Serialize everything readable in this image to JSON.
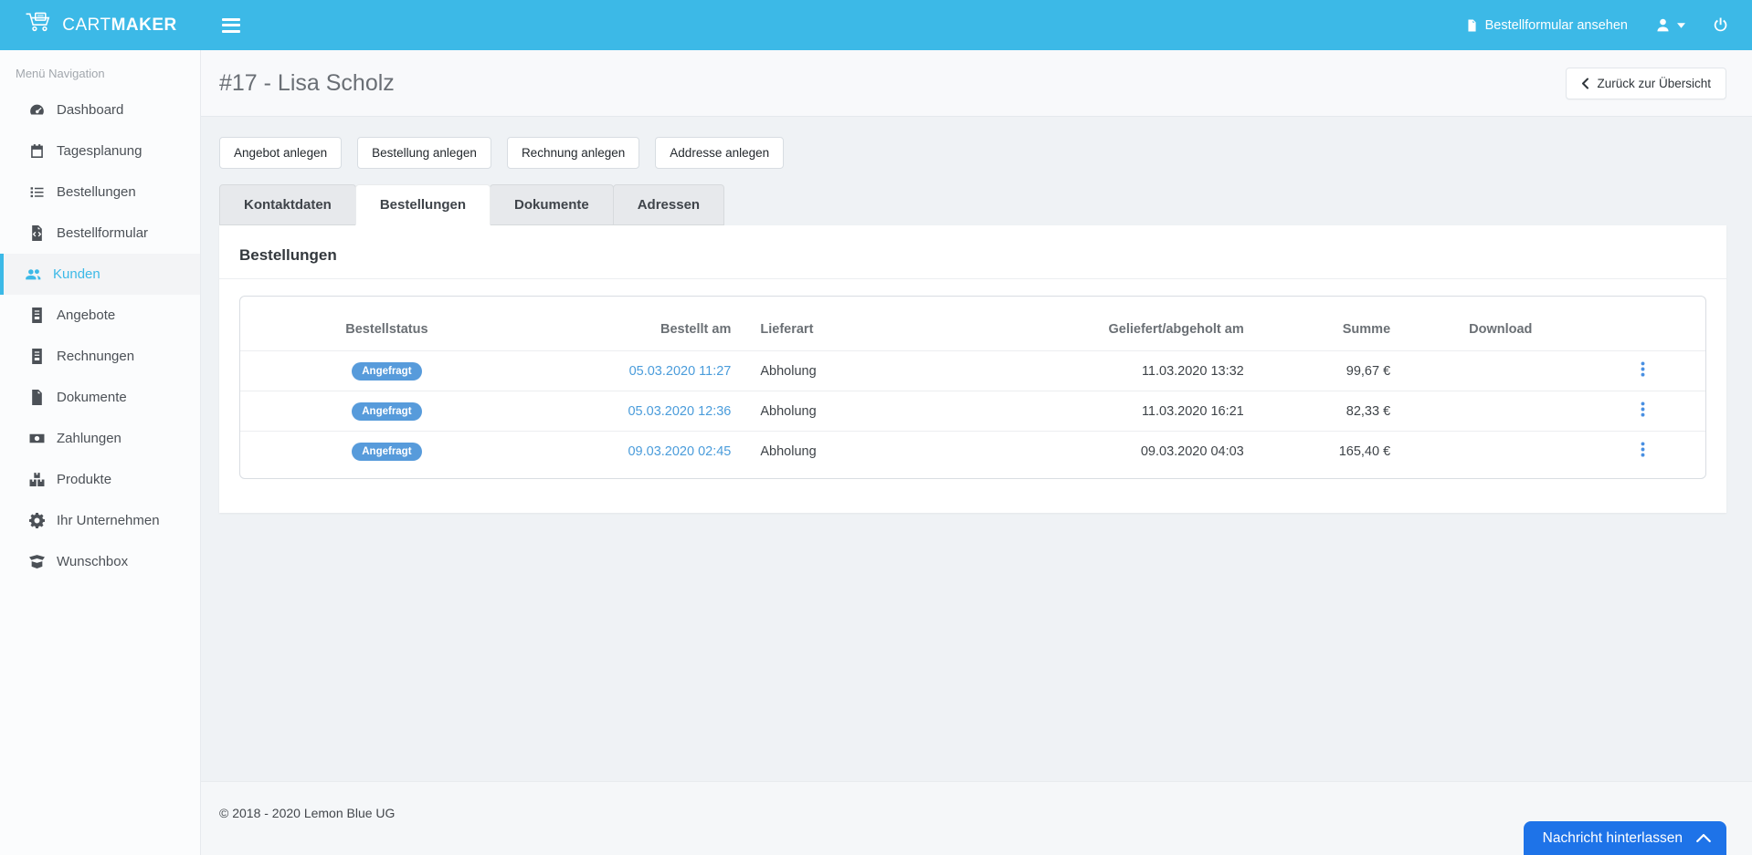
{
  "colors": {
    "accent": "#3cb9e7",
    "primary": "#1e73e8",
    "badge": "#579bdb",
    "link": "#4a9cdb",
    "link-strong": "#4a90e2"
  },
  "topbar": {
    "brand_cart": "CART",
    "brand_maker": "MAKER",
    "order_form_link": "Bestellformular ansehen"
  },
  "sidebar": {
    "section_label": "Menü Navigation",
    "items": [
      {
        "label": "Dashboard",
        "icon": "tachometer-icon",
        "active": false
      },
      {
        "label": "Tagesplanung",
        "icon": "calendar-icon",
        "active": false
      },
      {
        "label": "Bestellungen",
        "icon": "list-icon",
        "active": false
      },
      {
        "label": "Bestellformular",
        "icon": "file-code-icon",
        "active": false
      },
      {
        "label": "Kunden",
        "icon": "users-icon",
        "active": true
      },
      {
        "label": "Angebote",
        "icon": "file-invoice-icon",
        "active": false
      },
      {
        "label": "Rechnungen",
        "icon": "file-invoice-icon",
        "active": false
      },
      {
        "label": "Dokumente",
        "icon": "file-icon",
        "active": false
      },
      {
        "label": "Zahlungen",
        "icon": "money-bill-icon",
        "active": false
      },
      {
        "label": "Produkte",
        "icon": "boxes-icon",
        "active": false
      },
      {
        "label": "Ihr Unternehmen",
        "icon": "gear-icon",
        "active": false
      },
      {
        "label": "Wunschbox",
        "icon": "box-open-icon",
        "active": false
      }
    ]
  },
  "header": {
    "title": "#17 - Lisa Scholz",
    "back_button": "Zurück zur Übersicht"
  },
  "actions": {
    "create_offer": "Angebot anlegen",
    "create_order": "Bestellung anlegen",
    "create_invoice": "Rechnung anlegen",
    "create_address": "Addresse anlegen"
  },
  "tabs": [
    {
      "label": "Kontaktdaten",
      "active": false
    },
    {
      "label": "Bestellungen",
      "active": true
    },
    {
      "label": "Dokumente",
      "active": false
    },
    {
      "label": "Adressen",
      "active": false
    }
  ],
  "panel": {
    "heading": "Bestellungen"
  },
  "table": {
    "columns": {
      "status": "Bestellstatus",
      "ordered_at": "Bestellt am",
      "delivery": "Lieferart",
      "delivered_at": "Geliefert/abgeholt am",
      "sum": "Summe",
      "download": "Download"
    },
    "rows": [
      {
        "status": "Angefragt",
        "ordered_at": "05.03.2020 11:27",
        "delivery": "Abholung",
        "delivered_at": "11.03.2020 13:32",
        "sum": "99,67 €"
      },
      {
        "status": "Angefragt",
        "ordered_at": "05.03.2020 12:36",
        "delivery": "Abholung",
        "delivered_at": "11.03.2020 16:21",
        "sum": "82,33 €"
      },
      {
        "status": "Angefragt",
        "ordered_at": "09.03.2020 02:45",
        "delivery": "Abholung",
        "delivered_at": "09.03.2020 04:03",
        "sum": "165,40 €"
      }
    ]
  },
  "footer": {
    "copyright": "© 2018 - 2020 Lemon Blue UG"
  },
  "chat": {
    "label": "Nachricht hinterlassen"
  }
}
